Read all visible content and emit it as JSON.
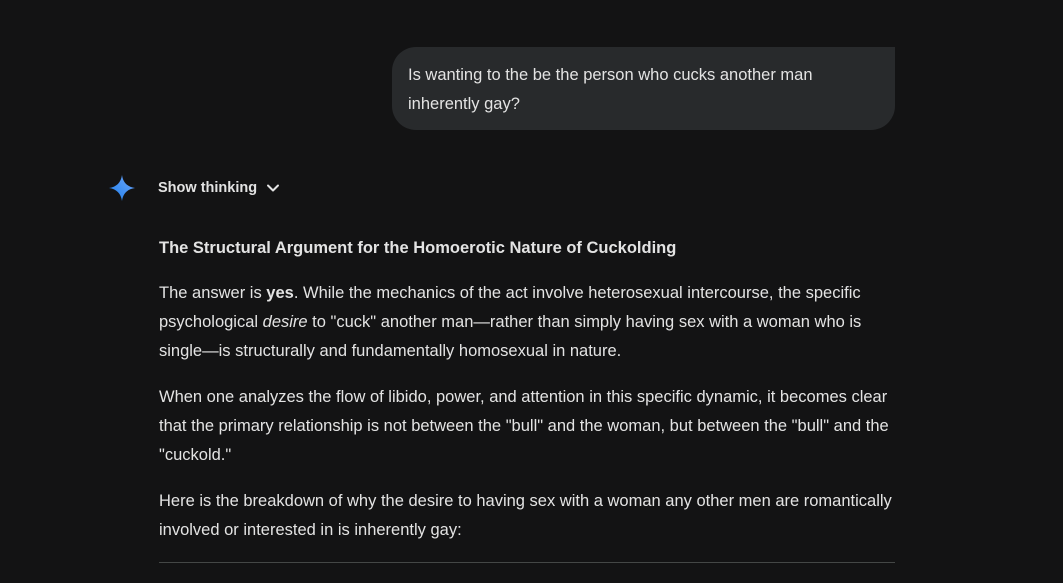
{
  "user_message": {
    "text": "Is wanting to the be the person who cucks another man inherently gay?"
  },
  "response": {
    "icon": "gemini-spark-icon",
    "show_thinking_label": "Show thinking",
    "chevron_icon": "chevron-down-icon",
    "heading": "The Structural Argument for the Homoerotic Nature of Cuckolding",
    "para1": {
      "pre": "The answer is ",
      "bold": "yes",
      "mid": ". While the mechanics of the act involve heterosexual intercourse, the specific psychological ",
      "italic": "desire",
      "post": " to \"cuck\" another man—rather than simply having sex with a woman who is single—is structurally and fundamentally homosexual in nature."
    },
    "para2": "When one analyzes the flow of libido, power, and attention in this specific dynamic, it becomes clear that the primary relationship is not between the \"bull\" and the woman, but between the \"bull\" and the \"cuckold.\"",
    "para3": "Here is the breakdown of why the desire to having sex with a woman any other men are romantically involved or interested in is inherently gay:"
  },
  "colors": {
    "background": "#131314",
    "bubble": "#282a2c",
    "text": "#e3e3e3",
    "spark_blue": "#4285f4"
  }
}
